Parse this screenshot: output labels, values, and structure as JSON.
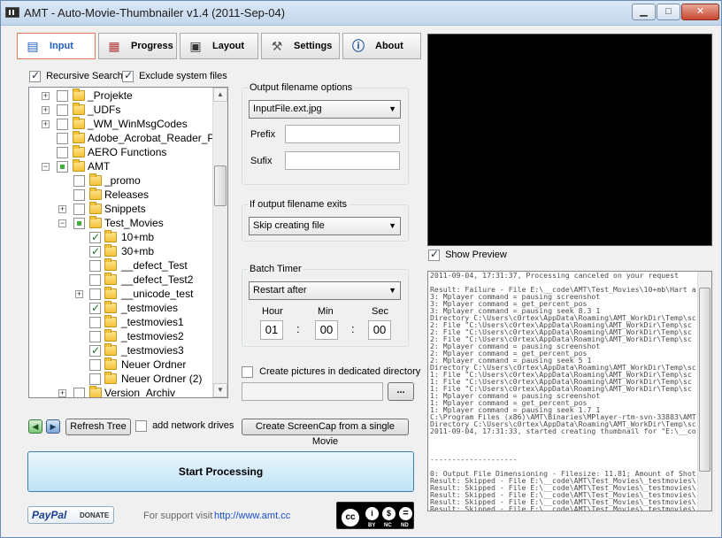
{
  "window": {
    "title": "AMT - Auto-Movie-Thumbnailer v1.4 (2011-Sep-04)"
  },
  "tabs": [
    {
      "label": "Input",
      "icon": "input-icon"
    },
    {
      "label": "Progress",
      "icon": "progress-icon"
    },
    {
      "label": "Layout",
      "icon": "layout-icon"
    },
    {
      "label": "Settings",
      "icon": "settings-icon"
    },
    {
      "label": "About",
      "icon": "about-icon"
    }
  ],
  "input": {
    "recursive_label": "Recursive Search",
    "exclude_label": "Exclude system files",
    "tree": [
      {
        "name": "_Projekte"
      },
      {
        "name": "_UDFs"
      },
      {
        "name": "_WM_WinMsgCodes"
      },
      {
        "name": "Adobe_Acrobat_Reader_Prin"
      },
      {
        "name": "AERO Functions"
      },
      {
        "name": "AMT"
      },
      {
        "name": "_promo"
      },
      {
        "name": "Releases"
      },
      {
        "name": "Snippets"
      },
      {
        "name": "Test_Movies"
      },
      {
        "name": "10+mb"
      },
      {
        "name": "30+mb"
      },
      {
        "name": "__defect_Test"
      },
      {
        "name": "__defect_Test2"
      },
      {
        "name": "__unicode_test"
      },
      {
        "name": "_testmovies"
      },
      {
        "name": "_testmovies1"
      },
      {
        "name": "_testmovies2"
      },
      {
        "name": "_testmovies3"
      },
      {
        "name": "Neuer Ordner"
      },
      {
        "name": "Neuer Ordner (2)"
      },
      {
        "name": "Version_Archiv"
      }
    ],
    "refresh_label": "Refresh Tree",
    "network_label": "add network drives"
  },
  "output": {
    "group_title": "Output filename options",
    "filename_value": "InputFile.ext.jpg",
    "prefix_label": "Prefix",
    "sufix_label": "Sufix",
    "exists_title": "If output filename exits",
    "exists_value": "Skip creating file",
    "batch_title": "Batch Timer",
    "batch_value": "Restart after",
    "hour_label": "Hour",
    "min_label": "Min",
    "sec_label": "Sec",
    "hour_value": "01",
    "min_value": "00",
    "sec_value": "00",
    "colon": ":",
    "dedicated_label": "Create pictures in dedicated directory",
    "browse_label": "...",
    "screencap_label": "Create ScreenCap from a single Movie"
  },
  "preview": {
    "show_label": "Show Preview"
  },
  "log": {
    "lines": [
      "2011-09-04, 17:31:37, Processing canceled on your request",
      "",
      "Result: Failure - File E:\\__code\\AMT\\Test_Movies\\10+mb\\Hart a",
      "3: Mplayer command = pausing screenshot",
      "3: Mplayer command = get_percent_pos",
      "3: Mplayer command = pausing seek 8.3 1",
      "Directory C:\\Users\\c0rtex\\AppData\\Roaming\\AMT_WorkDir\\Temp\\sc",
      "2: File \"C:\\Users\\c0rtex\\AppData\\Roaming\\AMT_WorkDir\\Temp\\sc",
      "2: File \"C:\\Users\\c0rtex\\AppData\\Roaming\\AMT_WorkDir\\Temp\\sc",
      "2: File \"C:\\Users\\c0rtex\\AppData\\Roaming\\AMT_WorkDir\\Temp\\sc",
      "2: Mplayer command = pausing screenshot",
      "2: Mplayer command = get_percent_pos",
      "2: Mplayer command = pausing seek 5 1",
      "Directory C:\\Users\\c0rtex\\AppData\\Roaming\\AMT_WorkDir\\Temp\\sc",
      "1: File \"C:\\Users\\c0rtex\\AppData\\Roaming\\AMT_WorkDir\\Temp\\sc",
      "1: File \"C:\\Users\\c0rtex\\AppData\\Roaming\\AMT_WorkDir\\Temp\\sc",
      "1: File \"C:\\Users\\c0rtex\\AppData\\Roaming\\AMT_WorkDir\\Temp\\sc",
      "1: Mplayer command = pausing screenshot",
      "1: Mplayer command = get_percent_pos",
      "1: Mplayer command = pausing seek 1.7 1",
      "C:\\Program Files (x86)\\AMT\\Binaries\\MPlayer-rtm-svn-33883\\AMT",
      "Directory C:\\Users\\c0rtex\\AppData\\Roaming\\AMT_WorkDir\\Temp\\sc",
      "2011-09-04, 17:31:33, started creating thumbnail for \"E:\\__co",
      "",
      "",
      "",
      "--------------------",
      "",
      "0: Output File Dimensioning - Filesize: 11.81; Amount of Shot",
      "Result: Skipped - File E:\\__code\\AMT\\Test_Movies\\_testmovies\\",
      "Result: Skipped - File E:\\__code\\AMT\\Test_Movies\\_testmovies\\",
      "Result: Skipped - File E:\\__code\\AMT\\Test_Movies\\_testmovies\\",
      "Result: Skipped - File E:\\__code\\AMT\\Test_Movies\\_testmovies\\",
      "Result: Skipped - File E:\\__code\\AMT\\Test_Movies\\_testmovies\\"
    ]
  },
  "actions": {
    "start_label": "Start Processing"
  },
  "footer": {
    "paypal_label": "PayPal",
    "donate_label": "DONATE",
    "support_label": "For support visit",
    "support_link": "http://www.amt.cc",
    "cc_by": "BY",
    "cc_nc": "NC",
    "cc_nd": "ND"
  }
}
